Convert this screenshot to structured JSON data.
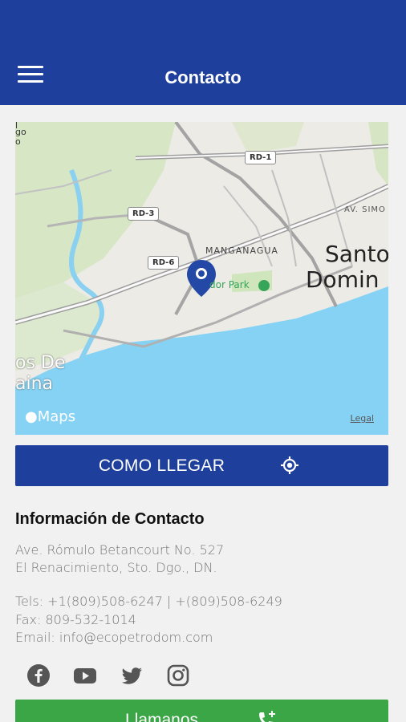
{
  "header": {
    "title": "Contacto",
    "menu_icon": "hamburger-menu-icon",
    "background": "#1e3f9b"
  },
  "map": {
    "labels": {
      "santo": "Santo",
      "domingo": "Domin",
      "manganagua": "MANGANAGUA",
      "park": "dor Park",
      "ave_simon": "AV. SIMO",
      "los_de": "os De",
      "aina": "aina",
      "corner_top1": "l",
      "corner_top2": "go",
      "corner_top3": "o"
    },
    "shields": {
      "rd1": "RD-1",
      "rd3": "RD-3",
      "rd6": "RD-6"
    },
    "brand": "Maps",
    "legal": "Legal",
    "pin_icon": "map-pin-icon"
  },
  "directions": {
    "label": "COMO LLEGAR",
    "icon": "location-target-icon"
  },
  "contact": {
    "title": "Información de Contacto",
    "address_line1": "Ave. Rómulo Betancourt No. 527",
    "address_line2": "El Renacimiento, Sto. Dgo., DN.",
    "tels": "Tels: +1(809)508-6247 | +(809)508-6249",
    "fax": "Fax: 809-532-1014",
    "email": "Email: info@ecopetrodom.com"
  },
  "social": [
    "facebook-icon",
    "youtube-icon",
    "twitter-icon",
    "instagram-icon"
  ],
  "call": {
    "label": "Llamanos",
    "icon": "phone-add-icon",
    "color": "#3aa645"
  }
}
